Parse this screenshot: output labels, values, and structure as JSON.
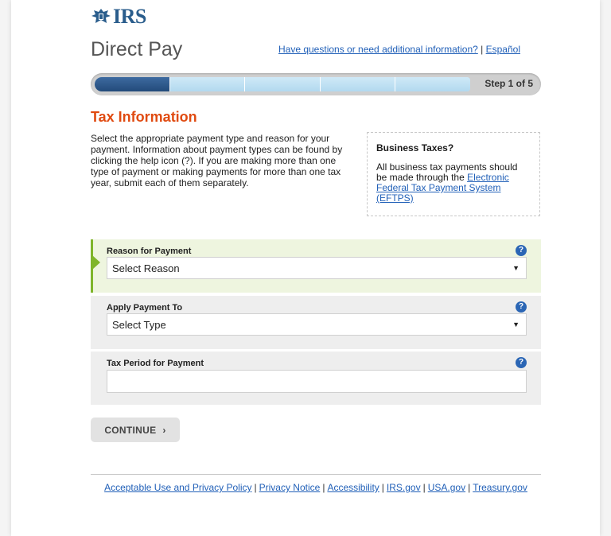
{
  "header": {
    "logo_text": "IRS",
    "app_title": "Direct Pay",
    "help_link": "Have questions or need additional information?",
    "separator": "|",
    "language_link": "Español"
  },
  "progress": {
    "current_step": 1,
    "total_steps": 5,
    "label": "Step 1 of 5",
    "completed_color": "#234b7a",
    "remaining_color": "#bfe0f2"
  },
  "section": {
    "title": "Tax Information",
    "title_color": "#e04a10",
    "intro": "Select the appropriate payment type and reason for your payment. Information about payment types can be found by clicking the help icon (?). If you are making more than one type of payment or making payments for more than one tax year, submit each of them separately."
  },
  "business_box": {
    "title": "Business Taxes?",
    "text": "All business tax payments should be made through the",
    "link": "Electronic Federal Tax Payment System (EFTPS)"
  },
  "form": {
    "help_glyph": "?",
    "reason": {
      "label": "Reason for Payment",
      "value": "Select Reason",
      "caret": "▼"
    },
    "apply_to": {
      "label": "Apply Payment To",
      "value": "Select Type",
      "caret": "▼"
    },
    "tax_period": {
      "label": "Tax Period for Payment",
      "value": ""
    },
    "active_color": "#7fb52b"
  },
  "continue_button": {
    "label": "CONTINUE",
    "glyph": "›"
  },
  "footer": {
    "links": [
      "Acceptable Use and Privacy Policy",
      "Privacy Notice",
      "Accessibility",
      "IRS.gov",
      "USA.gov",
      "Treasury.gov"
    ],
    "separator": "|"
  }
}
